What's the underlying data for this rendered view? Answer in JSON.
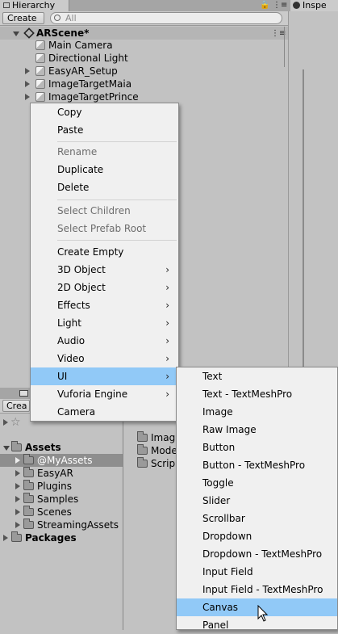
{
  "hierarchy": {
    "tab_label": "Hierarchy",
    "create_label": "Create",
    "search_placeholder": "All",
    "scene_name": "ARScene*",
    "items": [
      {
        "label": "Main Camera"
      },
      {
        "label": "Directional Light"
      },
      {
        "label": "EasyAR_Setup"
      },
      {
        "label": "ImageTargetMaia"
      },
      {
        "label": "ImageTargetPrince"
      }
    ]
  },
  "inspector": {
    "tab_label": "Inspe"
  },
  "project": {
    "create_label": "Crea",
    "tree": {
      "assets_label": "Assets",
      "folders": [
        {
          "label": "@MyAssets"
        },
        {
          "label": "EasyAR"
        },
        {
          "label": "Plugins"
        },
        {
          "label": "Samples"
        },
        {
          "label": "Scenes"
        },
        {
          "label": "StreamingAssets"
        }
      ],
      "packages_label": "Packages"
    },
    "content": [
      {
        "label": "Imag"
      },
      {
        "label": "Mode"
      },
      {
        "label": "Scrip"
      }
    ]
  },
  "context_menu": {
    "items": [
      {
        "label": "Copy",
        "enabled": true
      },
      {
        "label": "Paste",
        "enabled": true
      },
      {
        "label": "Rename",
        "enabled": false
      },
      {
        "label": "Duplicate",
        "enabled": true
      },
      {
        "label": "Delete",
        "enabled": true
      },
      {
        "label": "Select Children",
        "enabled": false
      },
      {
        "label": "Select Prefab Root",
        "enabled": false
      },
      {
        "label": "Create Empty",
        "enabled": true
      },
      {
        "label": "3D Object",
        "enabled": true
      },
      {
        "label": "2D Object",
        "enabled": true
      },
      {
        "label": "Effects",
        "enabled": true
      },
      {
        "label": "Light",
        "enabled": true
      },
      {
        "label": "Audio",
        "enabled": true
      },
      {
        "label": "Video",
        "enabled": true
      },
      {
        "label": "UI",
        "enabled": true
      },
      {
        "label": "Vuforia Engine",
        "enabled": true
      },
      {
        "label": "Camera",
        "enabled": true
      }
    ],
    "submenu_arrow": "›"
  },
  "ui_submenu": {
    "items": [
      {
        "label": "Text"
      },
      {
        "label": "Text - TextMeshPro"
      },
      {
        "label": "Image"
      },
      {
        "label": "Raw Image"
      },
      {
        "label": "Button"
      },
      {
        "label": "Button - TextMeshPro"
      },
      {
        "label": "Toggle"
      },
      {
        "label": "Slider"
      },
      {
        "label": "Scrollbar"
      },
      {
        "label": "Dropdown"
      },
      {
        "label": "Dropdown - TextMeshPro"
      },
      {
        "label": "Input Field"
      },
      {
        "label": "Input Field - TextMeshPro"
      },
      {
        "label": "Canvas"
      },
      {
        "label": "Panel"
      }
    ],
    "highlighted": "Canvas"
  },
  "colors": {
    "highlight": "#91c9f7",
    "menu_bg": "#f0f0f0",
    "panel_bg": "#c2c2c2"
  }
}
